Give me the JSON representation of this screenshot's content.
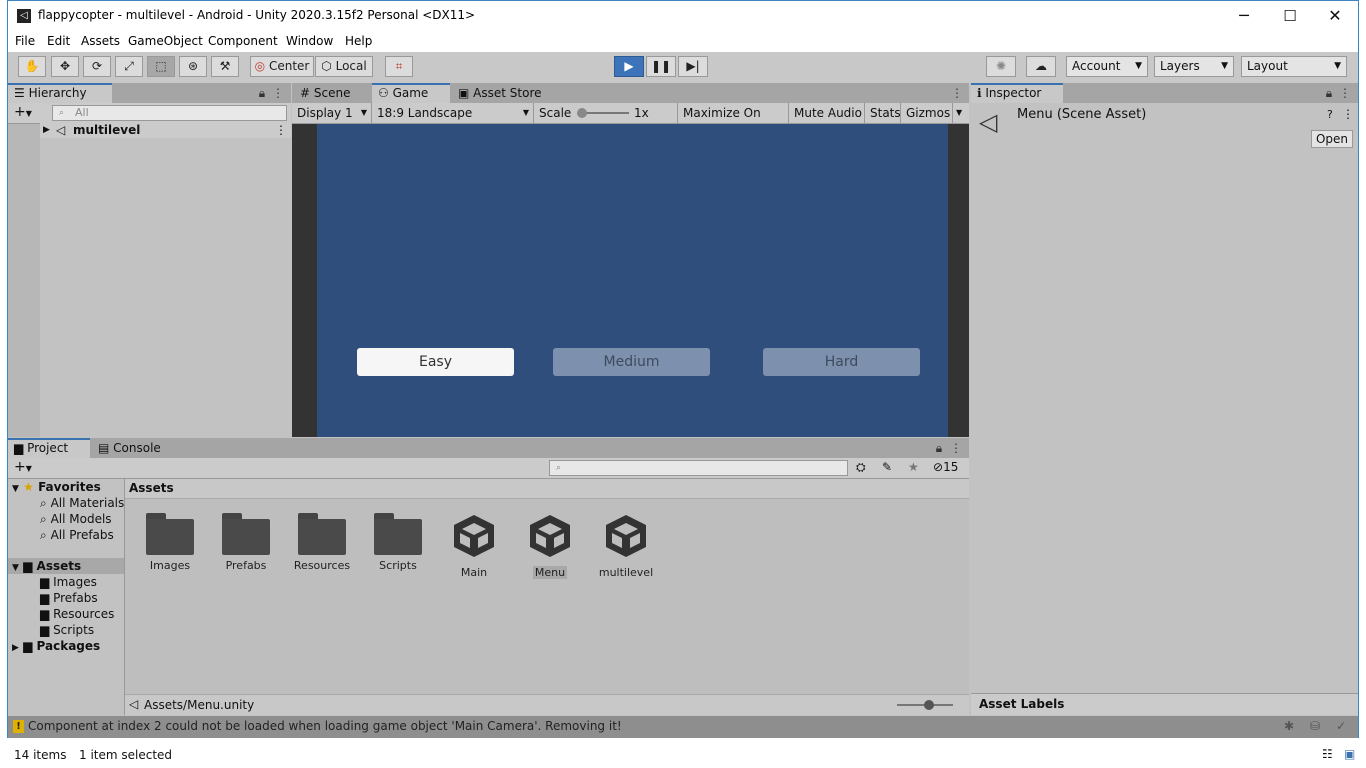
{
  "window": {
    "title": "flappycopter - multilevel - Android - Unity 2020.3.15f2 Personal <DX11>",
    "controls": {
      "minimize": "─",
      "maximize": "☐",
      "close": "✕"
    }
  },
  "menubar": [
    "File",
    "Edit",
    "Assets",
    "GameObject",
    "Component",
    "Window",
    "Help"
  ],
  "toolbar": {
    "pivot_label": "Center",
    "space_label": "Local",
    "account_label": "Account",
    "layers_label": "Layers",
    "layout_label": "Layout"
  },
  "hierarchy": {
    "tab_label": "Hierarchy",
    "search_placeholder": "All",
    "root_item": "multilevel"
  },
  "center": {
    "tabs": [
      "Scene",
      "Game",
      "Asset Store"
    ],
    "active_tab": "Game",
    "game_bar": {
      "display": "Display 1",
      "aspect": "18:9 Landscape",
      "scale_label": "Scale",
      "scale_value": "1x",
      "maximize": "Maximize On Play",
      "mute": "Mute Audio",
      "stats": "Stats",
      "gizmos": "Gizmos"
    },
    "game_view": {
      "background": "#2f4e7c",
      "buttons": [
        "Easy",
        "Medium",
        "Hard"
      ]
    }
  },
  "inspector": {
    "tab_label": "Inspector",
    "asset_title": "Menu (Scene Asset)",
    "open_button": "Open",
    "asset_labels": "Asset Labels"
  },
  "project": {
    "tabs": [
      "Project",
      "Console"
    ],
    "hidden_count": "15",
    "favorites": {
      "label": "Favorites",
      "items": [
        "All Materials",
        "All Models",
        "All Prefabs"
      ]
    },
    "assets_tree": {
      "label": "Assets",
      "items": [
        "Images",
        "Prefabs",
        "Resources",
        "Scripts"
      ]
    },
    "packages_label": "Packages",
    "breadcrumb": "Assets",
    "grid_items": [
      {
        "name": "Images",
        "type": "folder"
      },
      {
        "name": "Prefabs",
        "type": "folder"
      },
      {
        "name": "Resources",
        "type": "folder"
      },
      {
        "name": "Scripts",
        "type": "folder"
      },
      {
        "name": "Main",
        "type": "scene"
      },
      {
        "name": "Menu",
        "type": "scene",
        "selected": true
      },
      {
        "name": "multilevel",
        "type": "scene"
      }
    ],
    "selected_path": "Assets/Menu.unity"
  },
  "console_message": "Component at index 2 could not be loaded when loading game object 'Main Camera'. Removing it!",
  "explorer_status": {
    "items": "14 items",
    "selected": "1 item selected"
  },
  "colors": {
    "accent": "#3a72b0",
    "play_button": "#3d73b8",
    "game_background": "#2f4e7c"
  }
}
